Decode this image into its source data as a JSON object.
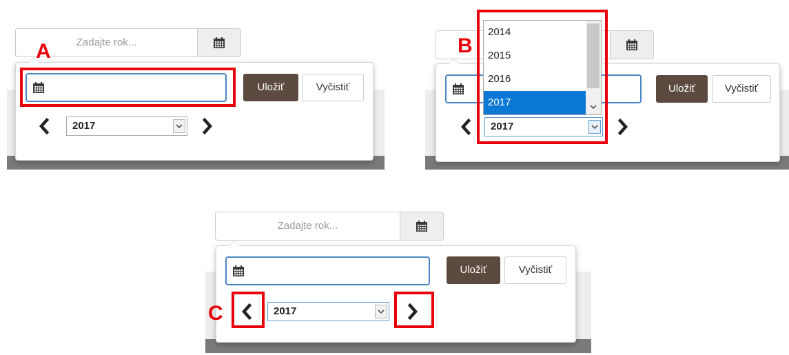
{
  "colors": {
    "highlight": "#e8000b",
    "save_button_bg": "#5c4a40",
    "focus_border": "#4a86c5",
    "dropdown_selected": "#0a78d4"
  },
  "markers": {
    "a": "A",
    "b": "B",
    "c": "C"
  },
  "widget": {
    "year_placeholder": "Zadajte rok...",
    "save_label": "Uložiť",
    "clear_label": "Vyčistiť",
    "selected_year": "2017",
    "calendar_icon": "calendar-icon",
    "prev_icon": "chevron-left-icon",
    "next_icon": "chevron-right-icon"
  },
  "dropdown": {
    "options": [
      "2014",
      "2015",
      "2016",
      "2017"
    ],
    "selected": "2017"
  }
}
